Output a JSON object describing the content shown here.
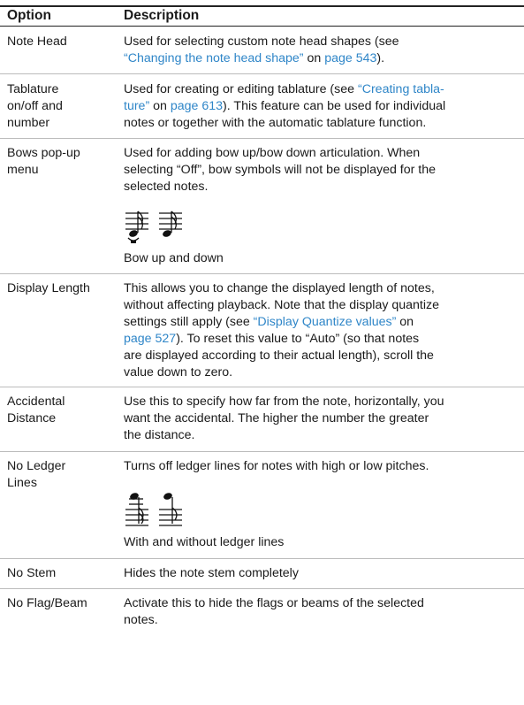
{
  "header": {
    "option": "Option",
    "description": "Description"
  },
  "rows": [
    {
      "option": "Note Head",
      "desc_1": "Used for selecting custom note head shapes (see ",
      "link_1": "“Changing the note head shape” ",
      "desc_2": "on ",
      "link_2": "page 543",
      "desc_3": ")."
    },
    {
      "option_l1": "Tablature",
      "option_l2": "on/off and",
      "option_l3": "number",
      "desc_1": "Used for creating or editing tablature (see ",
      "link_1": "“Creating tabla-",
      "link_1b": "ture” ",
      "desc_2": "on ",
      "link_2": "page 613",
      "desc_3": "). This feature can be used for individual",
      "desc_4": "notes or together with the automatic tablature function."
    },
    {
      "option_l1": "Bows pop-up",
      "option_l2": "menu",
      "desc_l1": "Used for adding bow up/bow down articulation. When",
      "desc_l2": "selecting “Off”, bow symbols will not be displayed for the",
      "desc_l3": "selected notes.",
      "caption": "Bow up and down"
    },
    {
      "option": "Display Length",
      "desc_l1": "This allows you to change the displayed length of notes,",
      "desc_l2": "without affecting playback. Note that the display quantize",
      "desc_l3a": "settings still apply (see ",
      "link_1": "“Display Quantize values” ",
      "desc_l3b": "on",
      "link_2": "page 527",
      "desc_l4": "). To reset this value to “Auto” (so that notes",
      "desc_l5": "are displayed according to their actual length), scroll the",
      "desc_l6": "value down to zero."
    },
    {
      "option_l1": "Accidental",
      "option_l2": "Distance",
      "desc_l1": "Use this to specify how far from the note, horizontally, you",
      "desc_l2": "want the accidental. The higher the number the greater",
      "desc_l3": "the distance."
    },
    {
      "option_l1": "No Ledger",
      "option_l2": "Lines",
      "desc_l1": "Turns off ledger lines for notes with high or low pitches.",
      "caption": "With and without ledger lines"
    },
    {
      "option": "No Stem",
      "desc_l1": "Hides the note stem completely"
    },
    {
      "option": "No Flag/Beam",
      "desc_l1": "Activate this to hide the flags or beams of the selected",
      "desc_l2": "notes."
    }
  ],
  "colors": {
    "link": "#2f86c8",
    "rule": "#222222",
    "separator": "#bcbcbc",
    "text": "#1a1a1a"
  },
  "figures": [
    {
      "name": "bow-up-down-notes",
      "depicts": "two notes with bow up and bow down symbols"
    },
    {
      "name": "ledger-lines-notes",
      "depicts": "two notes, with and without ledger lines"
    }
  ]
}
